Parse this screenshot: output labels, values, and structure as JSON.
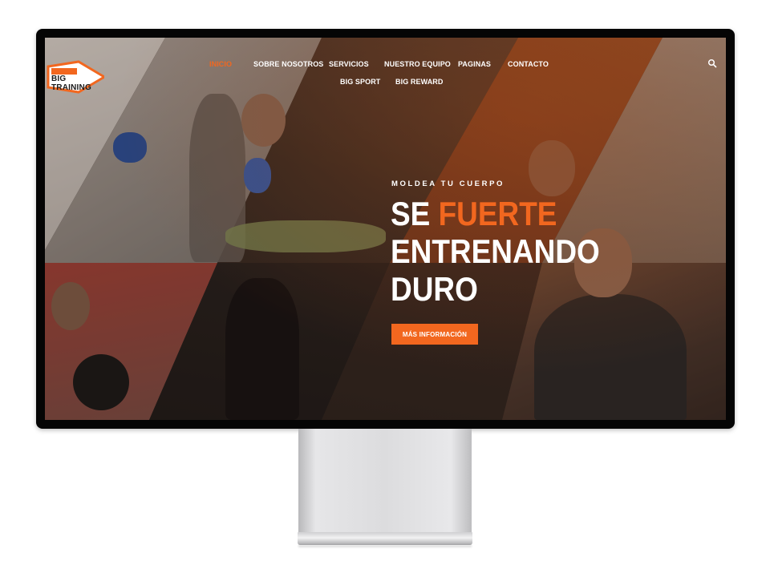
{
  "nav": {
    "items": [
      {
        "label": "INICIO",
        "active": true
      },
      {
        "label": "SOBRE NOSOTROS"
      },
      {
        "label": "SERVICIOS"
      },
      {
        "label": "NUESTRO EQUIPO"
      },
      {
        "label": "PAGINAS"
      },
      {
        "label": "CONTACTO"
      },
      {
        "label": "BIG SPORT"
      },
      {
        "label": "BIG REWARD"
      }
    ],
    "search_icon": "search-icon"
  },
  "logo": {
    "text": "BIG TRAINING"
  },
  "hero": {
    "kicker": "MOLDEA TU CUERPO",
    "title_part1": "SE",
    "title_accent": "FUERTE",
    "title_line2": "ENTRENANDO",
    "title_line3": "DURO",
    "cta_label": "MÁS INFORMACIÓN"
  },
  "colors": {
    "accent": "#f2671f",
    "text": "#ffffff",
    "bezel": "#050505"
  }
}
